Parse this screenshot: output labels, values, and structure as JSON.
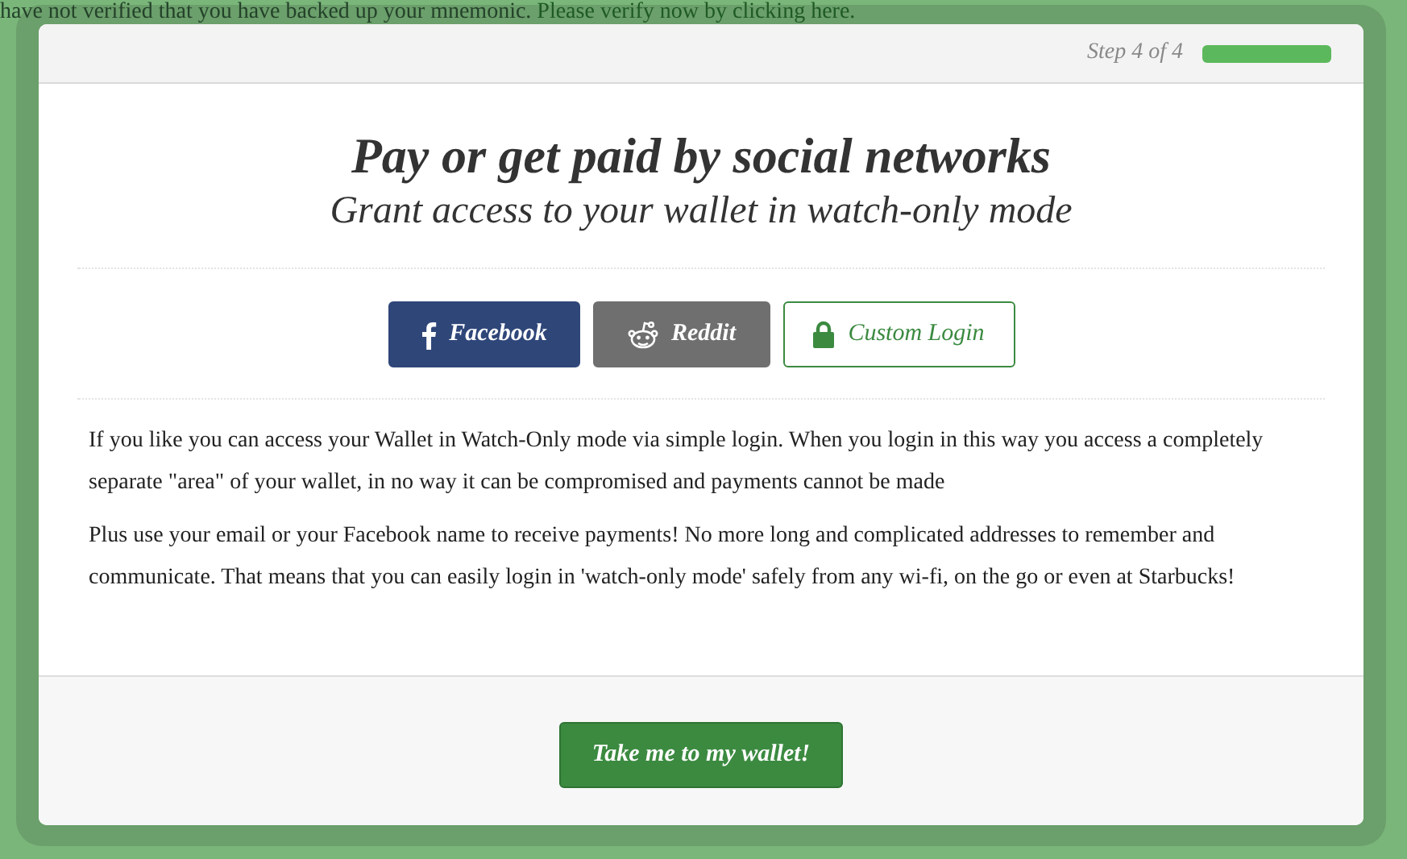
{
  "notice": {
    "text": "have not verified that you have backed up your mnemonic.",
    "link": "Please verify now by clicking here."
  },
  "dialog": {
    "step": "Step 4 of 4",
    "progress": {
      "level": 1
    },
    "title": "Pay or get paid by social networks",
    "subtitle": "Grant access to your wallet in watch-only mode",
    "logins": [
      {
        "kind": "facebook",
        "label": "Facebook"
      },
      {
        "kind": "reddit",
        "label": "Reddit"
      },
      {
        "kind": "custom",
        "label": "Custom Login"
      }
    ],
    "paragraphs": [
      "If you like you can access your Wallet in Watch-Only mode via simple login. When you login in this way you access a completely separate \"area\" of your wallet, in no way it can be compromised and payments cannot be made",
      "Plus use your email or your Facebook name to receive payments! No more long and complicated addresses to remember and communicate. That means that you can easily login in 'watch-only mode' safely from any wi-fi, on the go or even at Starbucks!"
    ],
    "action": "Take me to my wallet!"
  }
}
